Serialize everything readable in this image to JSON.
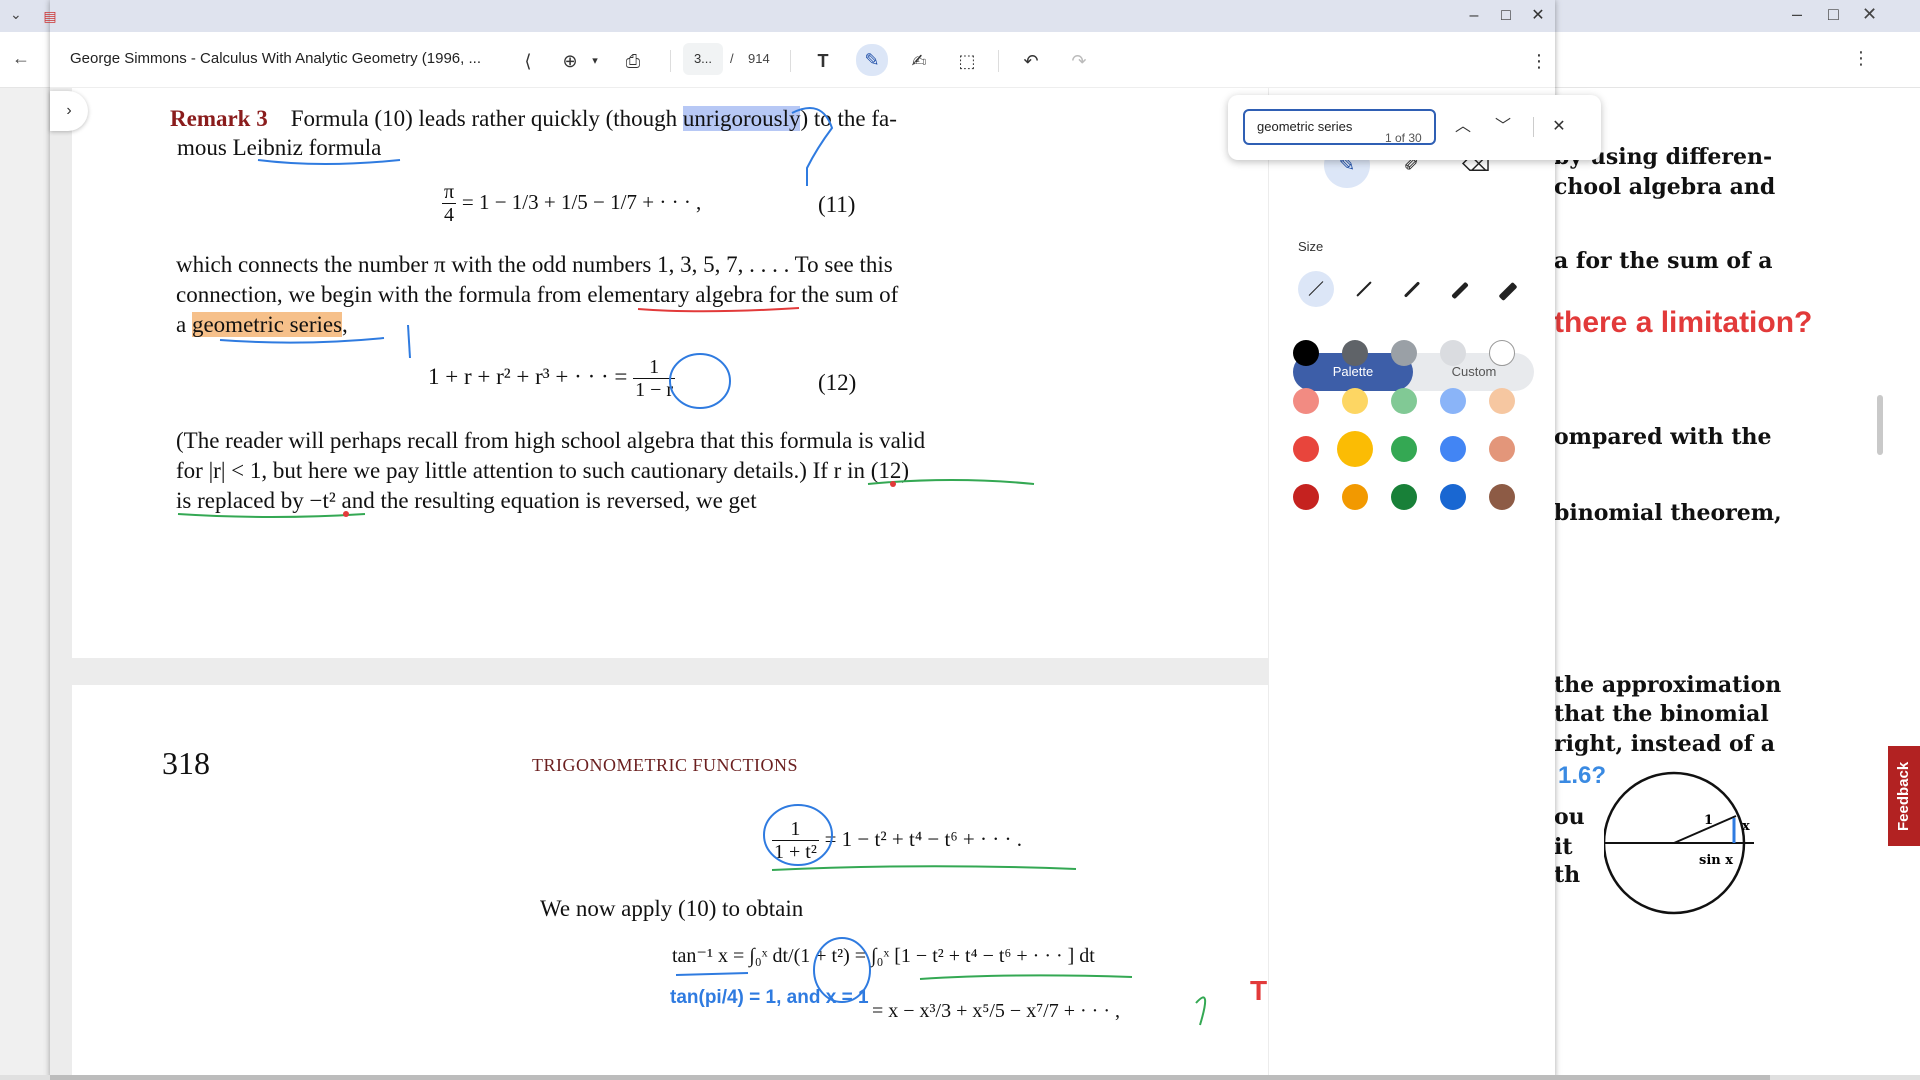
{
  "back_window": {
    "lines": [
      {
        "text": "by using differen-",
        "cls": ""
      },
      {
        "text": "chool algebra and",
        "cls": ""
      },
      {
        "text": "a for the sum of a",
        "cls": ""
      },
      {
        "text": "there a limitation?",
        "cls": "red"
      },
      {
        "text": "ompared with the",
        "cls": ""
      },
      {
        "text": "binomial theorem,",
        "cls": ""
      },
      {
        "text": "the approximation",
        "cls": ""
      },
      {
        "text": "that the binomial",
        "cls": ""
      },
      {
        "text": "right, instead of a",
        "cls": ""
      },
      {
        "text": "1.6?",
        "cls": "blue"
      },
      {
        "text": "ou",
        "cls": ""
      },
      {
        "text": "it",
        "cls": ""
      },
      {
        "text": "th",
        "cls": ""
      }
    ],
    "figure_label_x": "x",
    "figure_label_1": "1",
    "figure_label_sinx": "sin x",
    "feedback_label": "Feedback"
  },
  "toolbar": {
    "doc_title": "George Simmons - Calculus With Analytic Geometry (1996, ...",
    "page_current": "3...",
    "page_sep": "/",
    "page_total": "914"
  },
  "findbar": {
    "query": "geometric series",
    "count": "1 of 30"
  },
  "ink_panel": {
    "size_label": "Size",
    "palette_label": "Palette",
    "custom_label": "Custom",
    "colors": [
      [
        "#000000",
        "#5f6368",
        "#9aa0a6",
        "#dadce0",
        "#ffffff"
      ],
      [
        "#f28b82",
        "#fdd663",
        "#81c995",
        "#8ab4f8",
        "#f6c7a1"
      ],
      [
        "#e8453c",
        "#fbbc04",
        "#34a853",
        "#4285f4",
        "#e3967a"
      ],
      [
        "#c5221f",
        "#f29900",
        "#188038",
        "#1967d2",
        "#8d5b45"
      ]
    ],
    "selected_color": "#fbbc04"
  },
  "page1": {
    "remark": "Remark 3",
    "line1a": "Formula (10) leads rather quickly (though ",
    "line1_hl": "unrigorously",
    "line1b": ") to the fa-",
    "line2": "mous Leibniz formula",
    "eq11_lhs_num": "π",
    "eq11_lhs_den": "4",
    "eq11_terms": "= 1 − 1/3 + 1/5 − 1/7 + · · · ,",
    "eq11_num": "(11)",
    "para2_l1": "which connects the number π with the odd numbers 1, 3, 5, 7, . . . . To see this",
    "para2_l2": "connection, we begin with the formula from elementary algebra for the sum of",
    "para2_l3a": "a ",
    "para2_l3_hl": "geometric series",
    "para2_l3b": ",",
    "eq12_lhs": "1 + r + r² + r³ + · · ·  =",
    "eq12_num_top": "1",
    "eq12_num_bot": "1 − r",
    "eq12_num": "(12)",
    "para3_l1": "(The reader will perhaps recall from high school algebra that this formula is valid",
    "para3_l2": "for |r| < 1, but here we pay little attention to such cautionary details.) If r in (12)",
    "para3_l3": "is replaced by −t² and the resulting equation is reversed, we get"
  },
  "page2": {
    "page_number": "318",
    "chapter": "TRIGONOMETRIC FUNCTIONS",
    "eq_frac_top": "1",
    "eq_frac_bot": "1 + t²",
    "eq_rhs": "= 1 − t² + t⁴ − t⁶ + · · · .",
    "apply_text": "We now apply (10) to obtain",
    "integral_line": "tan⁻¹ x = ∫₀ˣ  dt/(1 + t²)  = ∫₀ˣ [1 − t² + t⁴ − t⁶ + · · · ] dt",
    "series_line": "= x − x³/3 + x⁵/5 − x⁷/7 + · · · ,",
    "note_blue": "tan(pi/4) = 1, and x = 1",
    "note_red": "Thi"
  }
}
